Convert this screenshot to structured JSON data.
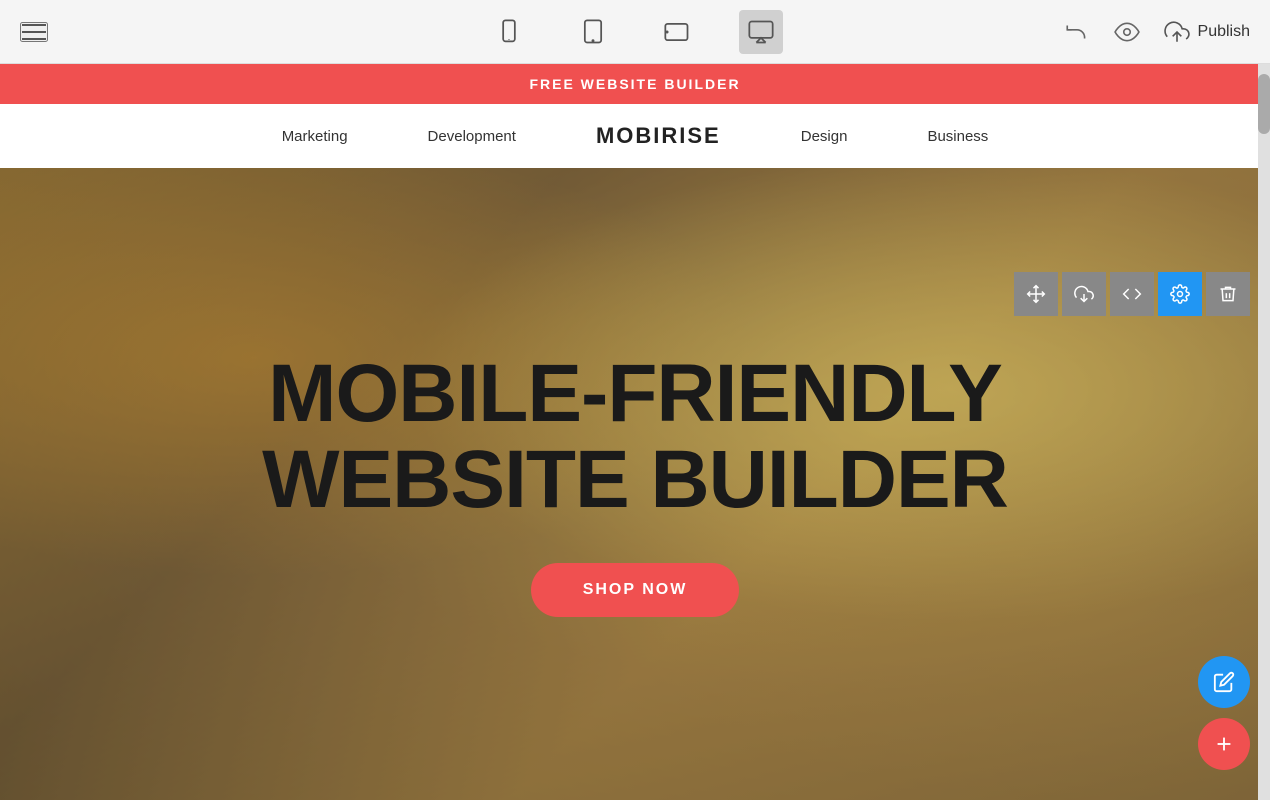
{
  "toolbar": {
    "publish_label": "Publish",
    "devices": [
      {
        "id": "mobile",
        "label": "Mobile view"
      },
      {
        "id": "tablet",
        "label": "Tablet view"
      },
      {
        "id": "tablet-landscape",
        "label": "Tablet landscape view"
      },
      {
        "id": "desktop",
        "label": "Desktop view",
        "active": true
      }
    ],
    "undo_label": "Undo",
    "preview_label": "Preview",
    "upload_label": "Upload"
  },
  "banner": {
    "text": "FREE WEBSITE BUILDER"
  },
  "nav": {
    "brand": "MOBIRISE",
    "links": [
      "Marketing",
      "Development",
      "Design",
      "Business"
    ]
  },
  "hero": {
    "title_line1": "MOBILE-FRIENDLY",
    "title_line2": "WEBSITE BUILDER",
    "cta_label": "SHOP NOW"
  },
  "section_toolbar": {
    "move_label": "Move",
    "download_label": "Download",
    "code_label": "Code",
    "settings_label": "Settings",
    "delete_label": "Delete"
  },
  "fab": {
    "edit_label": "Edit",
    "add_label": "Add"
  },
  "colors": {
    "accent": "#f05050",
    "primary": "#2196f3",
    "dark": "#1a1a1a",
    "toolbar_bg": "#f5f5f5"
  }
}
